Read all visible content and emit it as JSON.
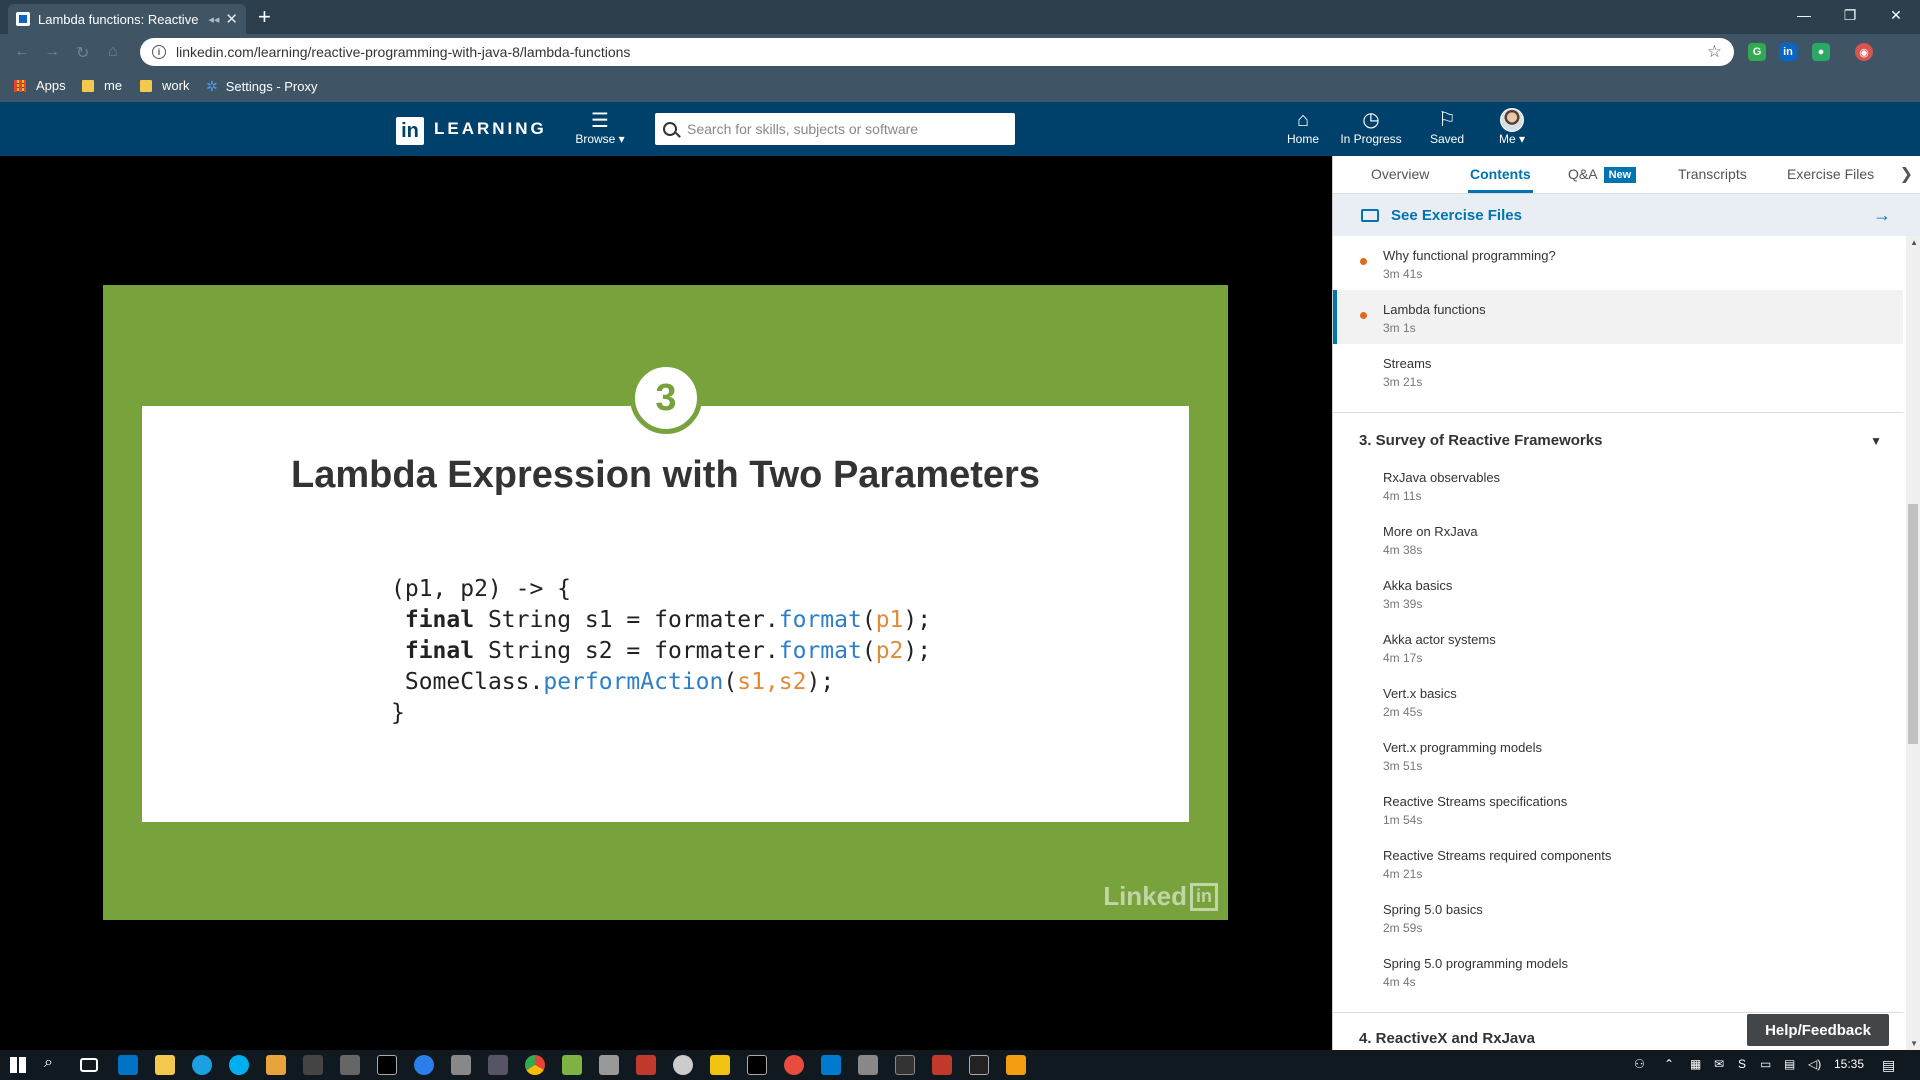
{
  "browser": {
    "tab_title": "Lambda functions: Reactive P",
    "url": "linkedin.com/learning/reactive-programming-with-java-8/lambda-functions",
    "bookmarks": [
      "Apps",
      "me",
      "work",
      "Settings - Proxy"
    ]
  },
  "header": {
    "logo_text": "LEARNING",
    "browse_label": "Browse",
    "search_placeholder": "Search for skills, subjects or software",
    "nav": {
      "home": "Home",
      "in_progress": "In Progress",
      "saved": "Saved",
      "me": "Me"
    }
  },
  "slide": {
    "number": "3",
    "title": "Lambda Expression with Two Parameters",
    "code": {
      "line1": "(p1, p2) -> {",
      "l2_kw": "final",
      "l2_mid": " String s1 = formater.",
      "l2_fn": "format",
      "l2_open": "(",
      "l2_arg": "p1",
      "l2_close": ");",
      "l3_kw": "final",
      "l3_mid": " String s2 = formater.",
      "l3_fn": "format",
      "l3_open": "(",
      "l3_arg": "p2",
      "l3_close": ");",
      "l4_pre": "SomeClass.",
      "l4_fn": "performAction",
      "l4_open": "(",
      "l4_arg": "s1,s2",
      "l4_close": ");",
      "line5": "}"
    },
    "watermark": "Linked",
    "watermark_in": "in"
  },
  "sidebar": {
    "tabs": [
      "Overview",
      "Contents",
      "Q&A",
      "Transcripts",
      "Exercise Files"
    ],
    "new_badge": "New",
    "exercise_files": "See Exercise Files",
    "items_top": [
      {
        "title": "Why functional programming?",
        "duration": "3m 41s"
      },
      {
        "title": "Lambda functions",
        "duration": "3m 1s"
      },
      {
        "title": "Streams",
        "duration": "3m 21s"
      }
    ],
    "section3": "3. Survey of Reactive Frameworks",
    "section3_items": [
      {
        "title": "RxJava observables",
        "duration": "4m 11s"
      },
      {
        "title": "More on RxJava",
        "duration": "4m 38s"
      },
      {
        "title": "Akka basics",
        "duration": "3m 39s"
      },
      {
        "title": "Akka actor systems",
        "duration": "4m 17s"
      },
      {
        "title": "Vert.x basics",
        "duration": "2m 45s"
      },
      {
        "title": "Vert.x programming models",
        "duration": "3m 51s"
      },
      {
        "title": "Reactive Streams specifications",
        "duration": "1m 54s"
      },
      {
        "title": "Reactive Streams required components",
        "duration": "4m 21s"
      },
      {
        "title": "Spring 5.0 basics",
        "duration": "2m 59s"
      },
      {
        "title": "Spring 5.0 programming models",
        "duration": "4m 4s"
      }
    ],
    "section4": "4. ReactiveX and RxJava",
    "help": "Help/Feedback"
  },
  "taskbar": {
    "clock": "15:35"
  },
  "colors": {
    "linkedin_header": "#00416b",
    "slide_green": "#78a23b",
    "accent_blue": "#0073b1",
    "progress_dot": "#e06a1b"
  }
}
